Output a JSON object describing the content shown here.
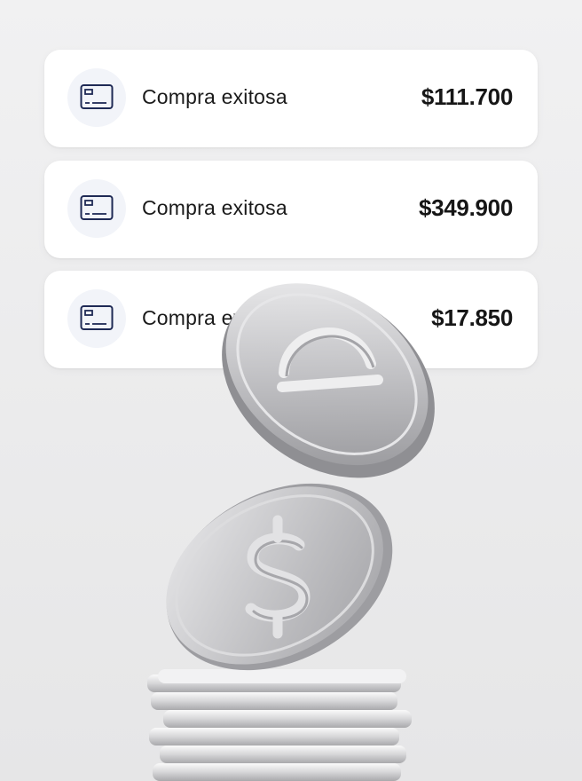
{
  "transactions": [
    {
      "label": "Compra exitosa",
      "amount": "$111.700",
      "icon": "credit-card-icon"
    },
    {
      "label": "Compra exitosa",
      "amount": "$349.900",
      "icon": "credit-card-icon"
    },
    {
      "label": "Compra exitosa",
      "amount": "$17.850",
      "icon": "credit-card-icon"
    }
  ],
  "colors": {
    "card": "#ffffff",
    "icon_bg": "#f2f4f9",
    "icon_stroke": "#1f2a55",
    "coin": "#c9c9cc"
  }
}
